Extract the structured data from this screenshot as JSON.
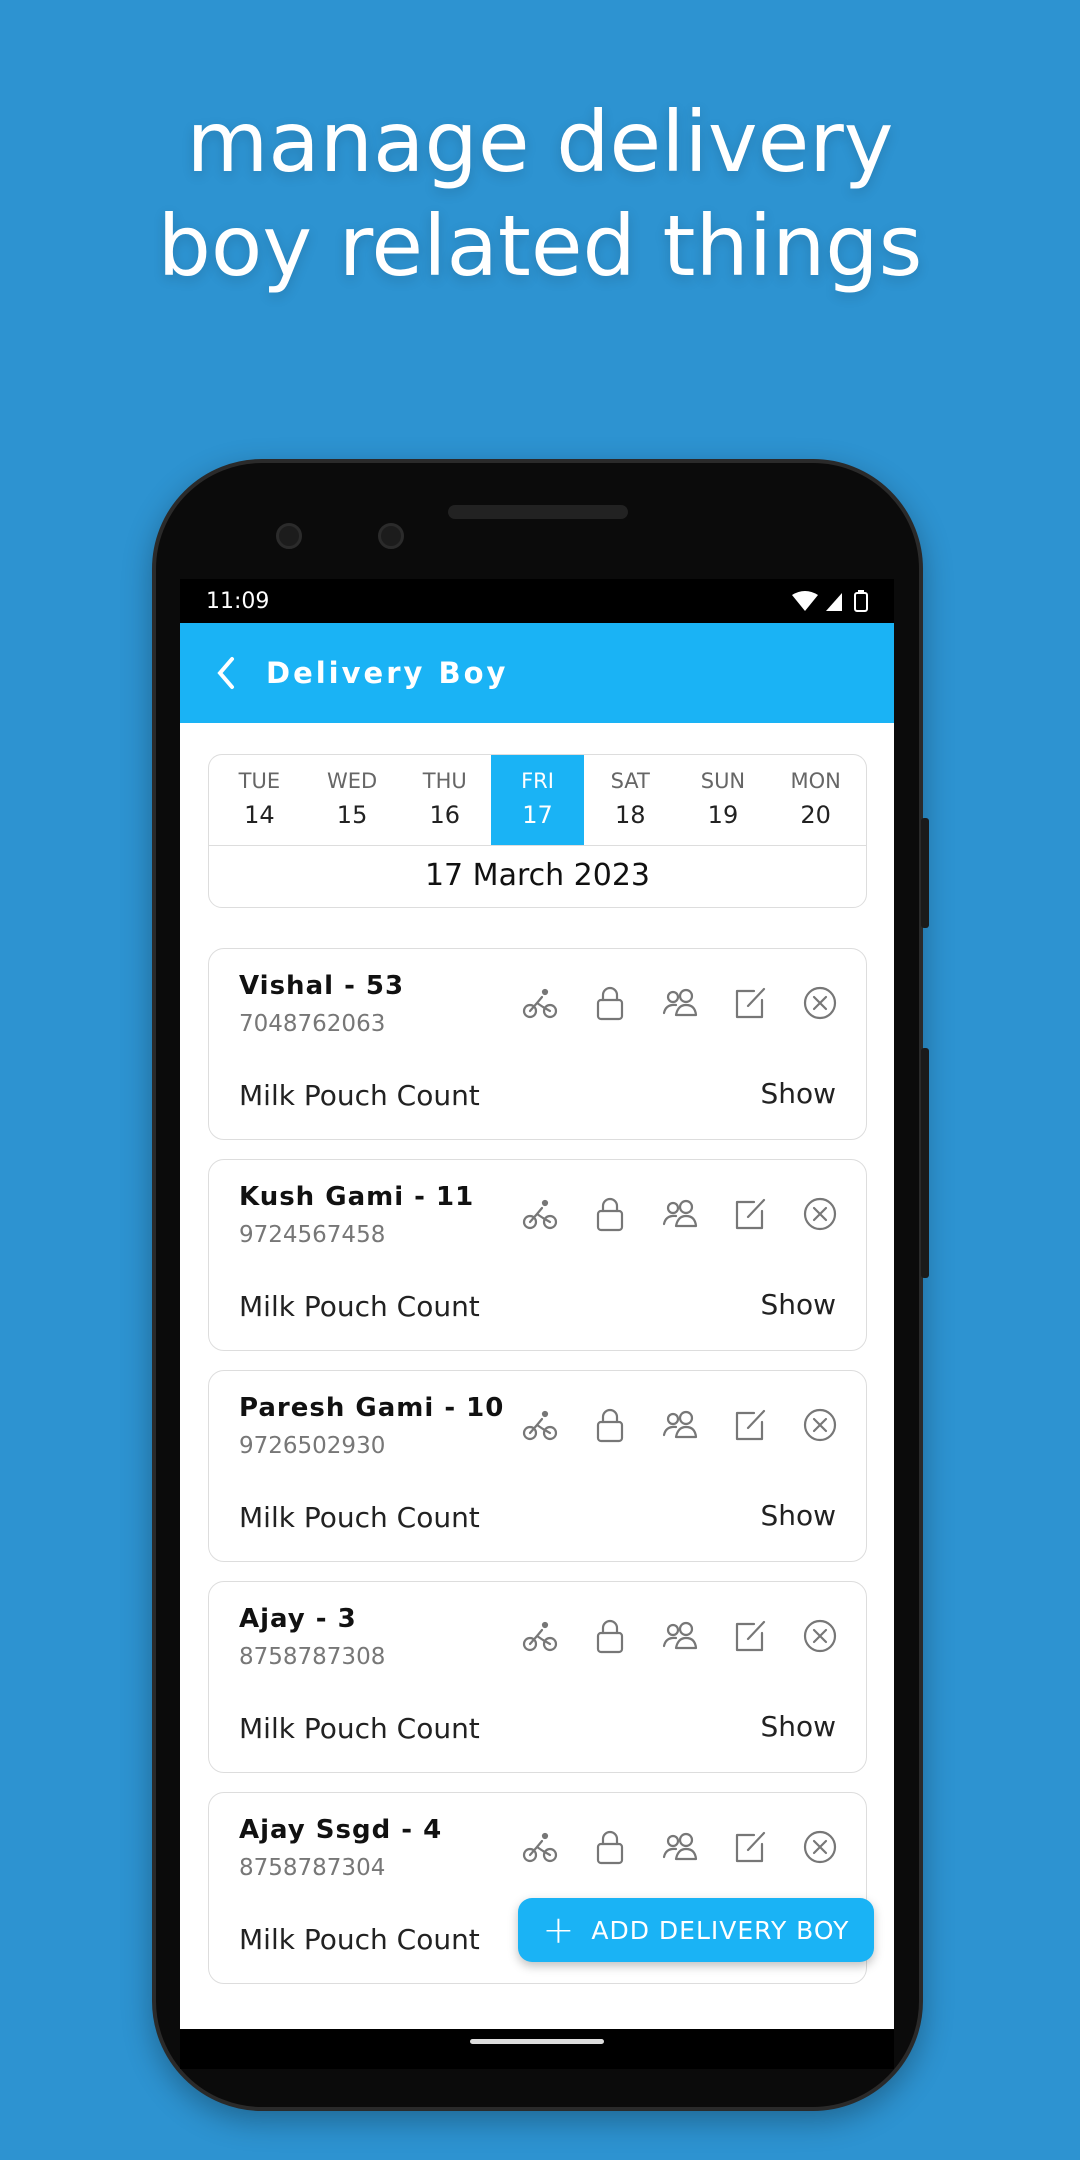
{
  "headline": [
    "manage delivery",
    "boy related things"
  ],
  "status_bar": {
    "time": "11:09",
    "icons": [
      "wifi-icon",
      "signal-icon",
      "battery-icon"
    ]
  },
  "app_bar": {
    "title": "Delivery Boy",
    "back_icon": "chevron-left-icon"
  },
  "accent_color": "#1ab3f5",
  "date_strip": {
    "days": [
      {
        "dow": "TUE",
        "num": "14"
      },
      {
        "dow": "WED",
        "num": "15"
      },
      {
        "dow": "THU",
        "num": "16"
      },
      {
        "dow": "FRI",
        "num": "17",
        "selected": true
      },
      {
        "dow": "SAT",
        "num": "18"
      },
      {
        "dow": "SUN",
        "num": "19"
      },
      {
        "dow": "MON",
        "num": "20"
      }
    ],
    "full_date": "17 March 2023"
  },
  "cards": [
    {
      "name": "Vishal - 53",
      "phone": "7048762063",
      "label": "Milk Pouch Count",
      "action": "Show"
    },
    {
      "name": "Kush Gami - 11",
      "phone": "9724567458",
      "label": "Milk Pouch Count",
      "action": "Show"
    },
    {
      "name": "Paresh Gami - 10",
      "phone": "9726502930",
      "label": "Milk Pouch Count",
      "action": "Show"
    },
    {
      "name": "Ajay - 3",
      "phone": "8758787308",
      "label": "Milk Pouch Count",
      "action": "Show"
    },
    {
      "name": "Ajay Ssgd - 4",
      "phone": "8758787304",
      "label": "Milk Pouch Count",
      "action": ""
    }
  ],
  "card_icons": [
    "bicycle-icon",
    "lock-icon",
    "users-icon",
    "edit-icon",
    "close-circle-icon"
  ],
  "fab": {
    "label": "ADD DELIVERY BOY"
  }
}
